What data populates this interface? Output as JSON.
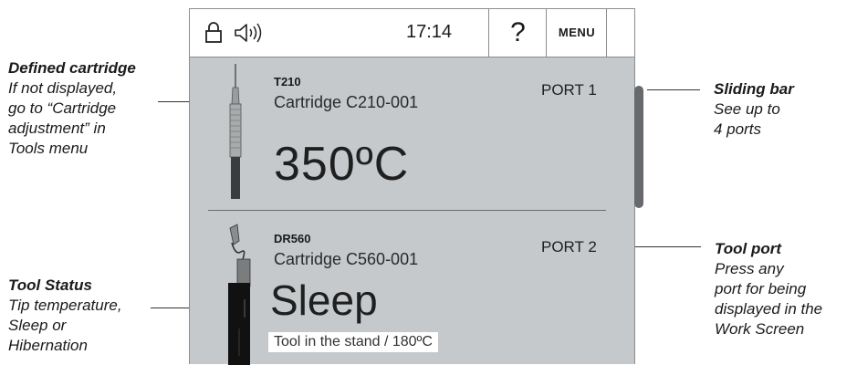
{
  "annotations": {
    "defined_cartridge": {
      "title": "Defined cartridge",
      "desc": "If not displayed,\ngo to “Cartridge\nadjustment” in\nTools menu"
    },
    "tool_status": {
      "title": "Tool Status",
      "desc": "Tip temperature,\nSleep or\nHibernation"
    },
    "sliding_bar": {
      "title": "Sliding bar",
      "desc": "See up to\n4 ports"
    },
    "tool_port": {
      "title": "Tool port",
      "desc": "Press any\nport for being\ndisplayed in the\nWork Screen"
    }
  },
  "topbar": {
    "time": "17:14",
    "help_label": "?",
    "menu_label": "MENU",
    "icons": [
      "lock-icon",
      "speaker-icon"
    ]
  },
  "ports": [
    {
      "model": "T210",
      "cartridge": "Cartridge  C210-001",
      "port": "PORT 1",
      "temperature": "350ºC"
    },
    {
      "model": "DR560",
      "cartridge": "Cartridge  C560-001",
      "port": "PORT 2",
      "state": "Sleep",
      "status_text": "Tool in the stand  / 180ºC"
    }
  ],
  "colors": {
    "screen_bg": "#c5c9cc",
    "topbar_bg": "#ffffff",
    "scrollbar": "#666a6c"
  }
}
